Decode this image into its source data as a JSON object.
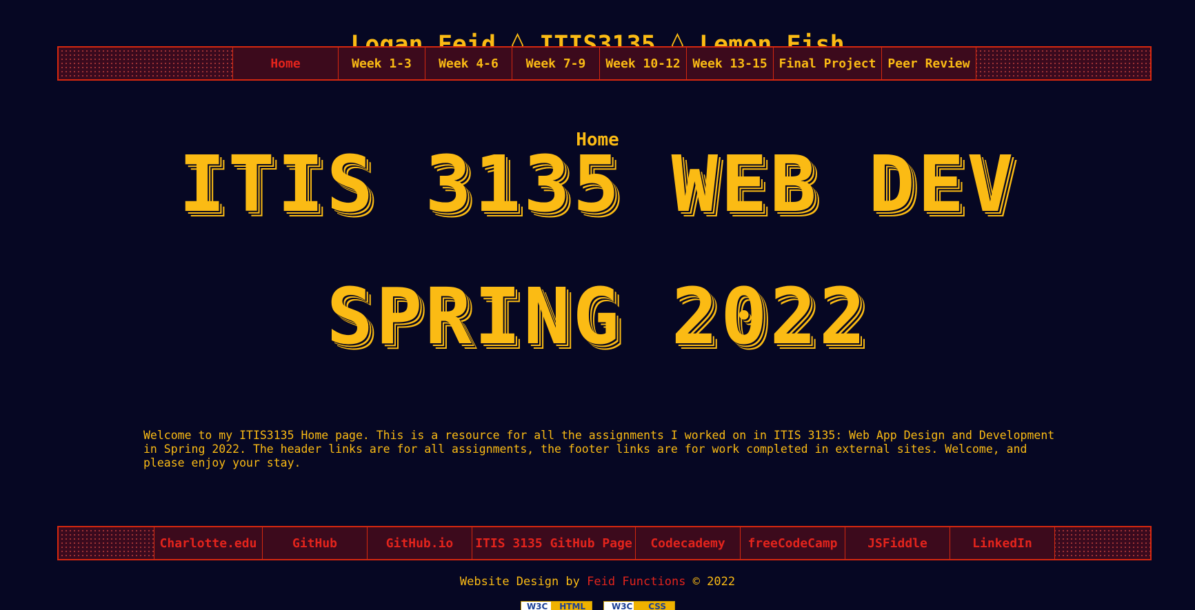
{
  "header": {
    "title": "Logan Feid ◊ ITIS3135 ◊ Lemon Fish"
  },
  "nav": {
    "items": [
      {
        "label": "Home",
        "active": true
      },
      {
        "label": "Week 1-3",
        "active": false
      },
      {
        "label": "Week 4-6",
        "active": false
      },
      {
        "label": "Week 7-9",
        "active": false
      },
      {
        "label": "Week 10-12",
        "active": false
      },
      {
        "label": "Week 13-15",
        "active": false
      },
      {
        "label": "Final Project",
        "active": false
      },
      {
        "label": "Peer Review",
        "active": false
      }
    ]
  },
  "main": {
    "heading": "Home",
    "hero_line_1": "ITIS 3135 WEB DEV",
    "hero_line_2": "SPRING 2022",
    "welcome": "Welcome to my ITIS3135 Home page. This is a resource for all the assignments I worked on in ITIS 3135: Web App Design and Development in Spring 2022. The header links are for all assignments, the footer links are for work completed in external sites. Welcome, and please enjoy your stay."
  },
  "footer_nav": {
    "items": [
      {
        "label": "Charlotte.edu"
      },
      {
        "label": "GitHub"
      },
      {
        "label": "GitHub.io"
      },
      {
        "label": "ITIS 3135 GitHub Page"
      },
      {
        "label": "Codecademy"
      },
      {
        "label": "freeCodeCamp"
      },
      {
        "label": "JSFiddle"
      },
      {
        "label": "LinkedIn"
      }
    ]
  },
  "footer": {
    "credit_prefix": "Website Design by ",
    "credit_brand": "Feid Functions",
    "credit_suffix": " © 2022",
    "badges": [
      {
        "left": "W3C",
        "right": "HTML"
      },
      {
        "left": "W3C",
        "right": "CSS"
      }
    ]
  },
  "colors": {
    "background": "#060723",
    "primary_text": "#fbbb14",
    "accent_red": "#e3241c",
    "nav_border": "#d6280f",
    "nav_background": "#3c0a1c"
  }
}
